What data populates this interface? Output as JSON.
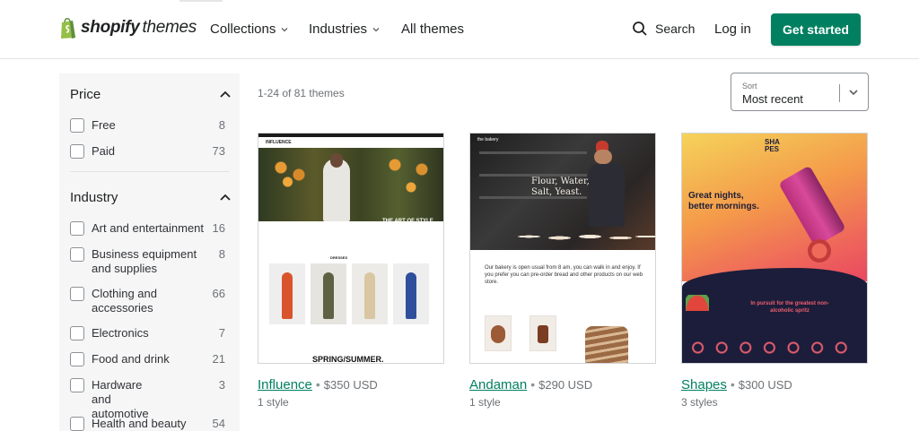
{
  "header": {
    "logo": {
      "brand": "shopify",
      "suffix": "themes"
    },
    "nav": [
      {
        "label": "Collections",
        "has_dropdown": true
      },
      {
        "label": "Industries",
        "has_dropdown": true
      },
      {
        "label": "All themes",
        "has_dropdown": false
      }
    ],
    "search_label": "Search",
    "login_label": "Log in",
    "cta_label": "Get started",
    "accent_color": "#008060"
  },
  "sidebar": {
    "price": {
      "title": "Price",
      "options": [
        {
          "label": "Free",
          "count": "8"
        },
        {
          "label": "Paid",
          "count": "73"
        }
      ]
    },
    "industry": {
      "title": "Industry",
      "options": [
        {
          "label": "Art and entertainment",
          "count": "16"
        },
        {
          "label": "Business equipment and supplies",
          "count": "8"
        },
        {
          "label": "Clothing and accessories",
          "count": "66"
        },
        {
          "label": "Electronics",
          "count": "7"
        },
        {
          "label": "Food and drink",
          "count": "21"
        },
        {
          "label": "Hardware and automotive",
          "count": "3"
        },
        {
          "label": "Health and beauty",
          "count": "54"
        }
      ]
    }
  },
  "results": {
    "count_text": "1-24 of 81 themes",
    "sort": {
      "label": "Sort",
      "value": "Most recent"
    }
  },
  "themes": [
    {
      "name": "Influence",
      "price": "$350 USD",
      "styles": "1 style",
      "preview": {
        "logo": "INFLUENCE",
        "hero_text": "THE ART OF STYLE",
        "tab": "DRESSES",
        "footer": "SPRING/SUMMER."
      }
    },
    {
      "name": "Andaman",
      "price": "$290 USD",
      "styles": "1 style",
      "preview": {
        "logo": "the bakery",
        "hero_text_1": "Flour, Water,",
        "hero_text_2": "Salt, Yeast.",
        "body": "Our bakery is open usual from 8 am, you can walk in and enjoy. If you prefer you can pre-order bread and other products on our web store."
      }
    },
    {
      "name": "Shapes",
      "price": "$300 USD",
      "styles": "3 styles",
      "preview": {
        "logo_1": "SHA",
        "logo_2": "PES",
        "headline_1": "Great nights,",
        "headline_2": "better mornings.",
        "tagline_1": "In pursuit for the greatest non-",
        "tagline_2": "alcoholic spritz"
      }
    }
  ]
}
